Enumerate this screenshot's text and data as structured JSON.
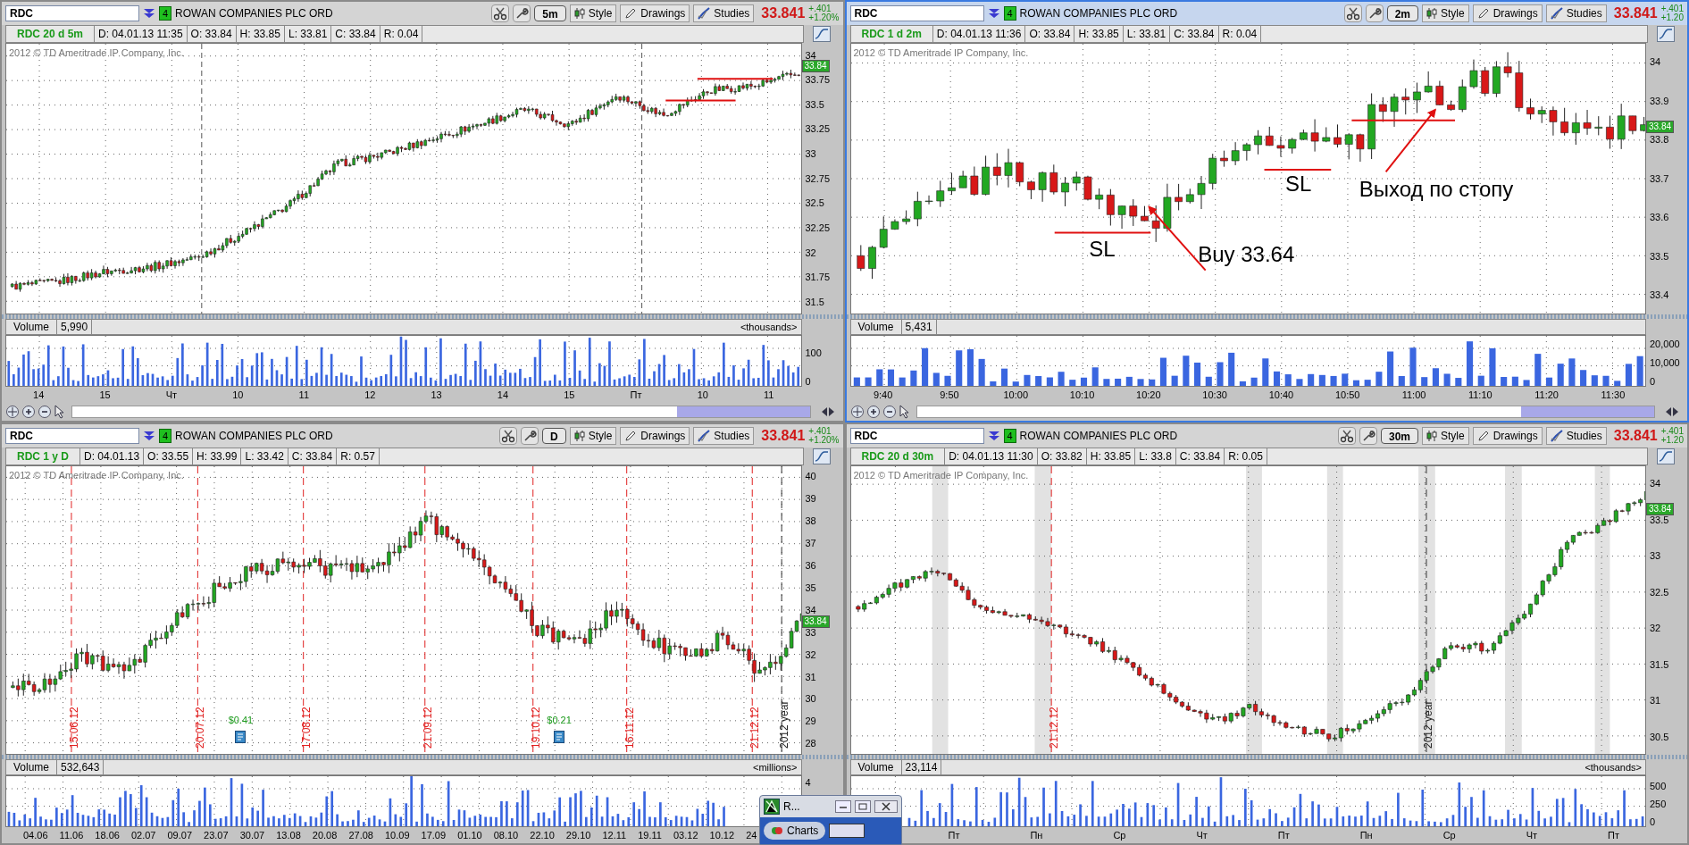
{
  "panels": [
    {
      "selected": false,
      "symbol": "RDC",
      "badge": "4",
      "company": "ROWAN COMPANIES PLC ORD",
      "timeframe": "5m",
      "style_button": "Style",
      "drawings_button": "Drawings",
      "studies_button": "Studies",
      "last_price": "33.841",
      "change": "+.401",
      "change_percent": "+1.20%",
      "info": [
        "RDC 20 d 5m",
        "D: 04.01.13 11:35",
        "O: 33.84",
        "H: 33.85",
        "L: 33.81",
        "C: 33.84",
        "R: 0.04"
      ],
      "copyright": "2012 © TD Ameritrade IP Company, Inc.",
      "price_axis": [
        "34",
        "33.75",
        "33.5",
        "33.25",
        "33",
        "32.75",
        "32.5",
        "32.25",
        "32",
        "31.75",
        "31.5"
      ],
      "price_tag": "33.84",
      "volume": {
        "label": "Volume",
        "value": "5,990",
        "unit": "<thousands>",
        "axis": [
          "100",
          "0"
        ]
      },
      "time_axis": [
        "14",
        "15",
        "Чт",
        "10",
        "11",
        "12",
        "13",
        "14",
        "15",
        "Пт",
        "10",
        "11"
      ]
    },
    {
      "selected": true,
      "symbol": "RDC",
      "badge": "4",
      "company": "ROWAN COMPANIES PLC ORD",
      "timeframe": "2m",
      "style_button": "Style",
      "drawings_button": "Drawings",
      "studies_button": "Studies",
      "last_price": "33.841",
      "change": "+.401",
      "change_percent": "+1.20",
      "info": [
        "RDC 1 d 2m",
        "D: 04.01.13 11:36",
        "O: 33.84",
        "H: 33.85",
        "L: 33.81",
        "C: 33.84",
        "R: 0.04"
      ],
      "copyright": "2012 © TD Ameritrade IP Company, Inc.",
      "price_axis": [
        "34",
        "33.9",
        "33.8",
        "33.7",
        "33.6",
        "33.5",
        "33.4"
      ],
      "price_tag": "33.84",
      "annotations": [
        "SL",
        "Buy 33.64",
        "SL",
        "Выход по стопу"
      ],
      "volume": {
        "label": "Volume",
        "value": "5,431",
        "axis": [
          "20,000",
          "10,000",
          "0"
        ]
      },
      "time_axis": [
        "9:40",
        "9:50",
        "10:00",
        "10:10",
        "10:20",
        "10:30",
        "10:40",
        "10:50",
        "11:00",
        "11:10",
        "11:20",
        "11:30"
      ]
    },
    {
      "selected": false,
      "symbol": "RDC",
      "badge": "4",
      "company": "ROWAN COMPANIES PLC ORD",
      "timeframe": "D",
      "style_button": "Style",
      "drawings_button": "Drawings",
      "studies_button": "Studies",
      "last_price": "33.841",
      "change": "+.401",
      "change_percent": "+1.20%",
      "info": [
        "RDC 1 y D",
        "D: 04.01.13",
        "O: 33.55",
        "H: 33.99",
        "L: 33.42",
        "C: 33.84",
        "R: 0.57"
      ],
      "copyright": "2012 © TD Ameritrade IP Company, Inc.",
      "price_axis": [
        "40",
        "39",
        "38",
        "37",
        "36",
        "35",
        "34",
        "33",
        "32",
        "31",
        "30",
        "29",
        "28"
      ],
      "price_tag": "33.84",
      "markers": [
        {
          "kind": "date",
          "label": "15.06.12"
        },
        {
          "kind": "date",
          "label": "20.07.12"
        },
        {
          "kind": "date",
          "label": "17.08.12"
        },
        {
          "kind": "date",
          "label": "21.09.12"
        },
        {
          "kind": "date",
          "label": "19.10.12"
        },
        {
          "kind": "date",
          "label": "16.11.12"
        },
        {
          "kind": "date",
          "label": "21.12.12"
        },
        {
          "kind": "year",
          "label": "2012 year"
        }
      ],
      "dividends": [
        "$0.41",
        "$0.21"
      ],
      "volume": {
        "label": "Volume",
        "value": "532,643",
        "unit": "<millions>",
        "axis": [
          "4"
        ]
      },
      "time_axis": [
        "04.06",
        "11.06",
        "18.06",
        "02.07",
        "09.07",
        "23.07",
        "30.07",
        "13.08",
        "20.08",
        "27.08",
        "10.09",
        "17.09",
        "01.10",
        "08.10",
        "22.10",
        "29.10",
        "12.11",
        "19.11",
        "03.12",
        "10.12",
        "24"
      ]
    },
    {
      "selected": false,
      "symbol": "RDC",
      "badge": "4",
      "company": "ROWAN COMPANIES PLC ORD",
      "timeframe": "30m",
      "style_button": "Style",
      "drawings_button": "Drawings",
      "studies_button": "Studies",
      "last_price": "33.841",
      "change": "+.401",
      "change_percent": "+1.20",
      "info": [
        "RDC 20 d 30m",
        "D: 04.01.13 11:30",
        "O: 33.82",
        "H: 33.85",
        "L: 33.8",
        "C: 33.84",
        "R: 0.05"
      ],
      "copyright": "2012 © TD Ameritrade IP Company, Inc.",
      "price_axis": [
        "34",
        "33.5",
        "33",
        "32.5",
        "32",
        "31.5",
        "31",
        "30.5"
      ],
      "price_tag": "33.84",
      "markers": [
        {
          "kind": "date",
          "label": "21.12.12"
        },
        {
          "kind": "year",
          "label": "2012 year"
        }
      ],
      "volume": {
        "label": "Volume",
        "value": "23,114",
        "unit": "<thousands>",
        "axis": [
          "500",
          "250",
          "0"
        ]
      },
      "time_axis": [
        "Пт",
        "Пн",
        "Ср",
        "Чт",
        "Пт",
        "Пн",
        "Ср",
        "Чт",
        "Пт"
      ]
    }
  ],
  "mini_window": {
    "title": "R...",
    "button": "Charts"
  }
}
